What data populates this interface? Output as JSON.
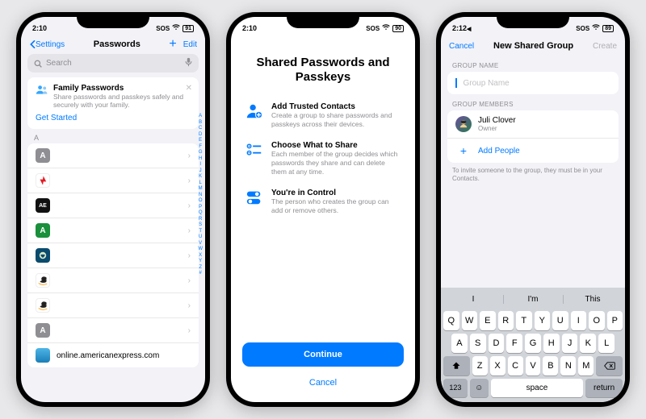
{
  "status": {
    "time": "2:10",
    "sos": "SOS",
    "signal": "􀙇",
    "batteries": [
      "91",
      "90",
      "89"
    ]
  },
  "phone1": {
    "nav": {
      "back": "Settings",
      "title": "Passwords",
      "edit": "Edit"
    },
    "search": {
      "placeholder": "Search"
    },
    "promo": {
      "title": "Family Passwords",
      "subtitle": "Share passwords and passkeys safely and securely with your family.",
      "cta": "Get Started"
    },
    "section_letter": "A",
    "rows": [
      {
        "label": ""
      },
      {
        "label": ""
      },
      {
        "label": ""
      },
      {
        "label": ""
      },
      {
        "label": ""
      },
      {
        "label": ""
      },
      {
        "label": ""
      },
      {
        "label": ""
      },
      {
        "label": "online.americanexpress.com"
      }
    ],
    "index": [
      "A",
      "B",
      "C",
      "D",
      "E",
      "F",
      "G",
      "H",
      "I",
      "J",
      "K",
      "L",
      "M",
      "N",
      "O",
      "P",
      "Q",
      "R",
      "S",
      "T",
      "U",
      "V",
      "W",
      "X",
      "Y",
      "Z",
      "#"
    ]
  },
  "phone2": {
    "title": "Shared Passwords and Passkeys",
    "features": [
      {
        "title": "Add Trusted Contacts",
        "sub": "Create a group to share passwords and passkeys across their devices."
      },
      {
        "title": "Choose What to Share",
        "sub": "Each member of the group decides which passwords they share and can delete them at any time."
      },
      {
        "title": "You're in Control",
        "sub": "The person who creates the group can add or remove others."
      }
    ],
    "continue": "Continue",
    "cancel": "Cancel"
  },
  "phone3": {
    "nav": {
      "cancel": "Cancel",
      "title": "New Shared Group",
      "create": "Create"
    },
    "group_name_label": "GROUP NAME",
    "group_name_placeholder": "Group Name",
    "members_label": "GROUP MEMBERS",
    "member": {
      "name": "Juli Clover",
      "role": "Owner"
    },
    "add_people": "Add People",
    "hint": "To invite someone to the group, they must be in your Contacts.",
    "keyboard": {
      "suggestions": [
        "I",
        "I'm",
        "This"
      ],
      "row1": [
        "Q",
        "W",
        "E",
        "R",
        "T",
        "Y",
        "U",
        "I",
        "O",
        "P"
      ],
      "row2": [
        "A",
        "S",
        "D",
        "F",
        "G",
        "H",
        "J",
        "K",
        "L"
      ],
      "row3": [
        "Z",
        "X",
        "C",
        "V",
        "B",
        "N",
        "M"
      ],
      "numbers": "123",
      "space": "space",
      "return": "return"
    }
  }
}
